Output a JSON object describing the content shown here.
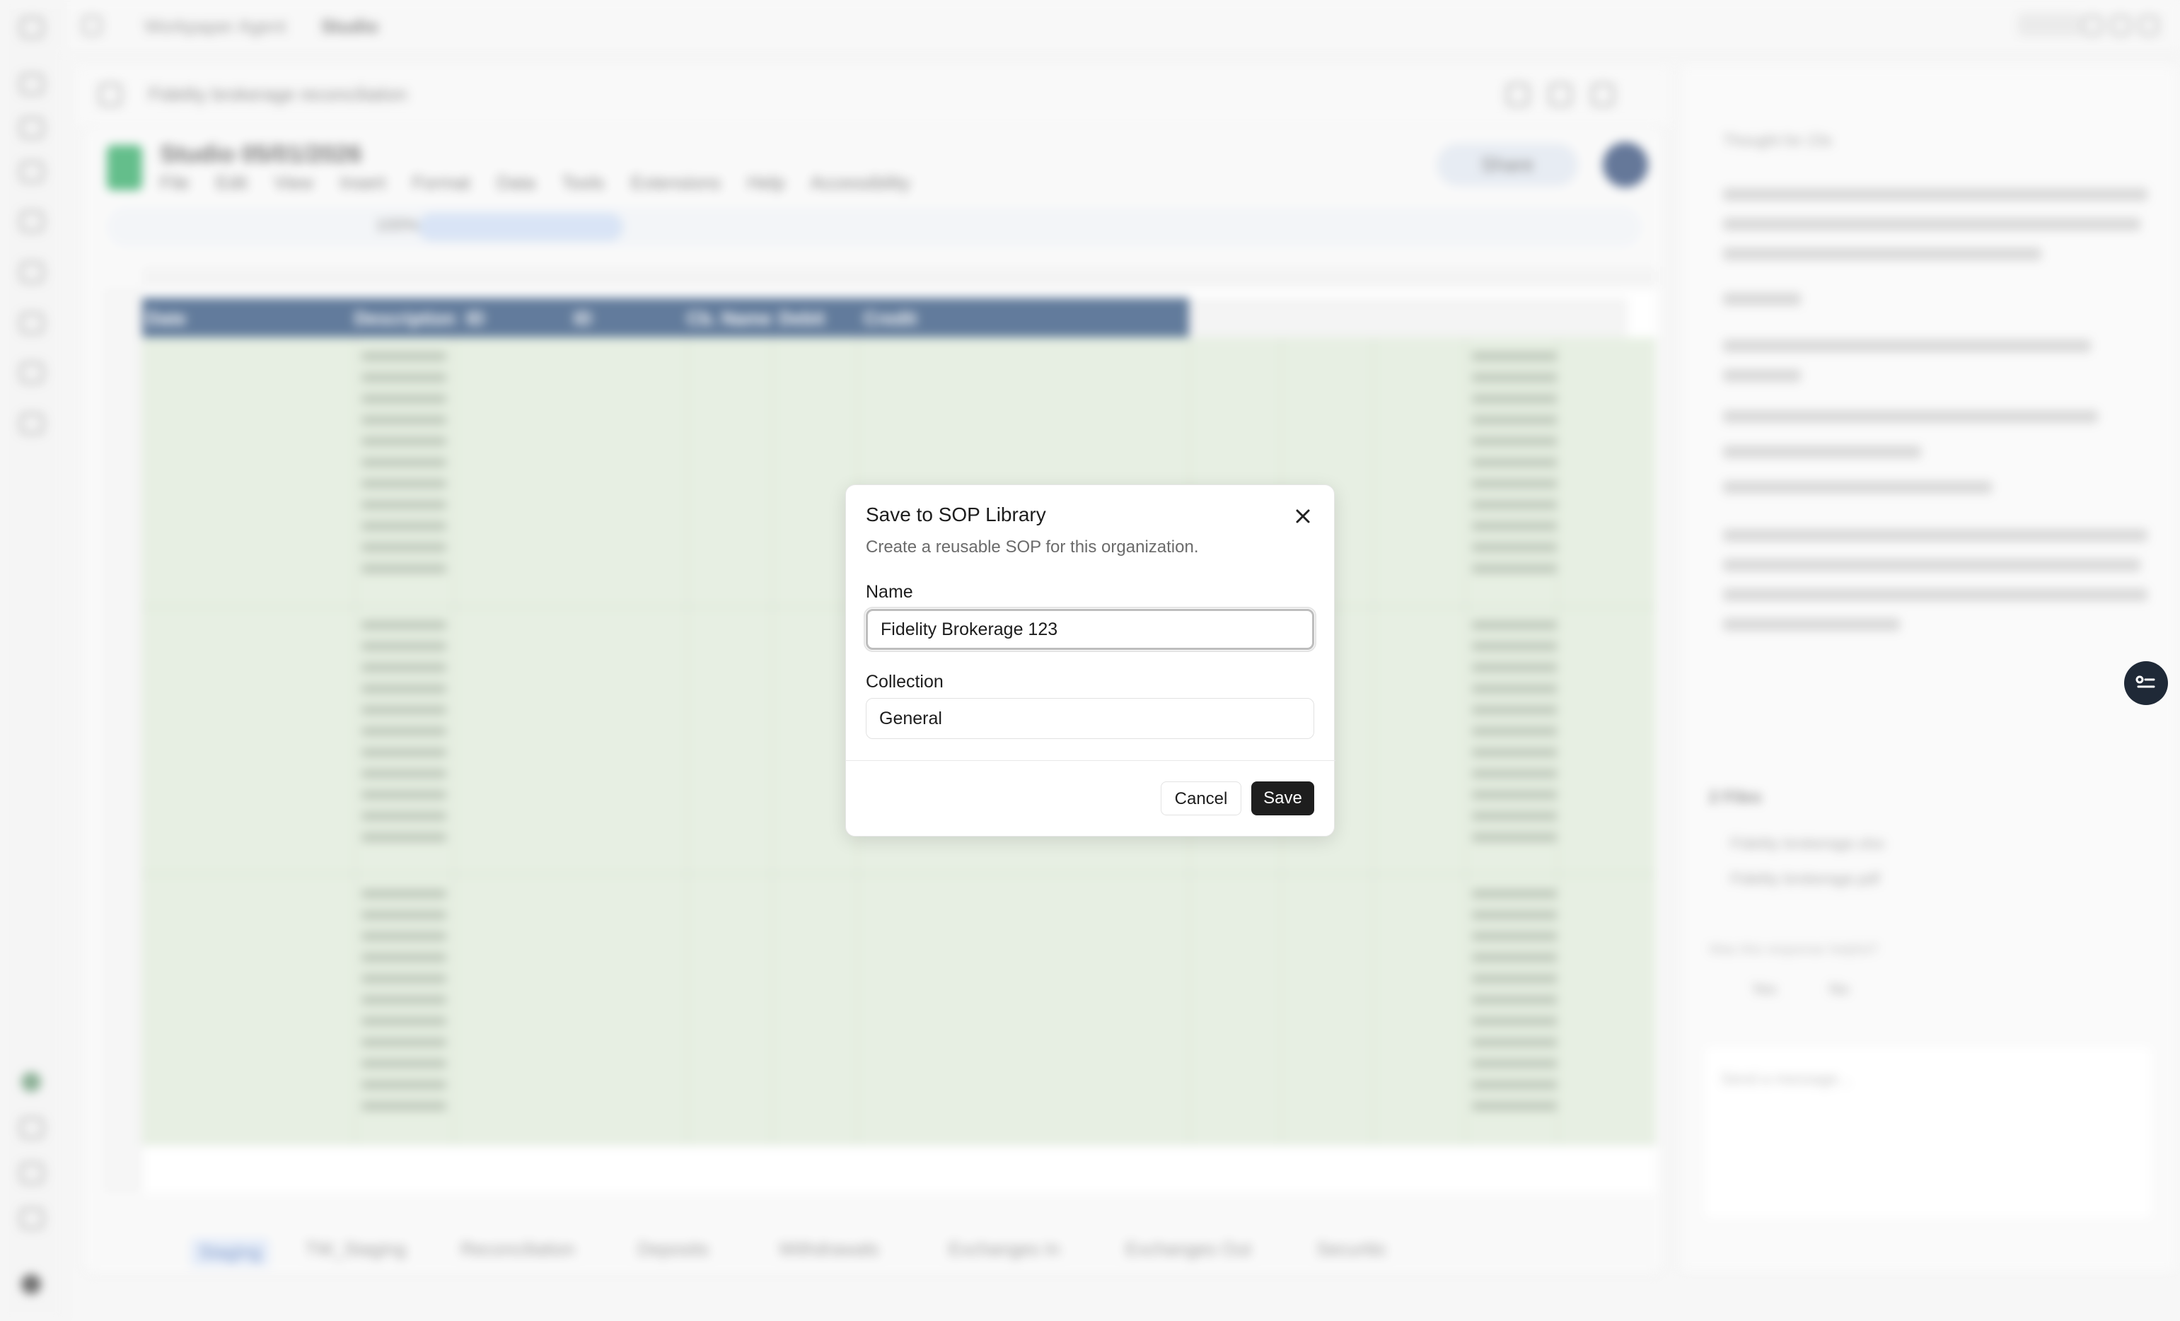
{
  "app": {
    "breadcrumb": [
      "Workpaper Agent",
      "Studio"
    ],
    "document_title": "Fidelity brokerage reconciliation"
  },
  "spreadsheet": {
    "name": "Studio 05/01/2026",
    "menus": [
      "File",
      "Edit",
      "View",
      "Insert",
      "Format",
      "Data",
      "Tools",
      "Extensions",
      "Help",
      "Accessibility"
    ],
    "share_label": "Share",
    "zoom": "100%",
    "columns": [
      "Date",
      "Description",
      "ID",
      "ID",
      "Cb. Name",
      "Debit",
      "Credit"
    ],
    "sheet_tabs": [
      "Staging",
      "TW_Staging",
      "Reconciliation",
      "Deposits",
      "Withdrawals",
      "Exchanges In",
      "Exchanges Out",
      "Securitic"
    ]
  },
  "side_panel": {
    "sections": [
      "Thought for 23s",
      "2 Files"
    ],
    "files": [
      "Fidelity brokerage.xlsx",
      "Fidelity brokerage.pdf"
    ],
    "feedback_prompt": "Was this response helpful?",
    "feedback_yes": "Yes",
    "feedback_no": "No",
    "message_placeholder": "Send a message..."
  },
  "dialog": {
    "title": "Save to SOP Library",
    "subtitle": "Create a reusable SOP for this organization.",
    "name_label": "Name",
    "name_value": "Fidelity Brokerage 123",
    "collection_label": "Collection",
    "collection_value": "General",
    "cancel_label": "Cancel",
    "save_label": "Save",
    "close_icon": "close-icon"
  },
  "colors": {
    "header_blue": "#1f4371",
    "highlight_green": "#dde9d7",
    "primary_button": "#1e1e1e"
  }
}
